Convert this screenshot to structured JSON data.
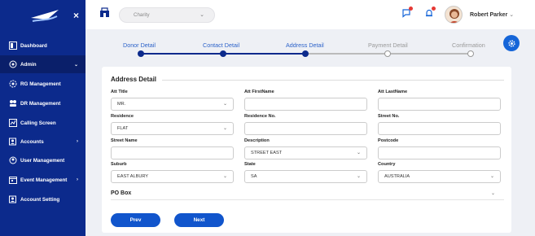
{
  "sidebar": {
    "close_label": "×",
    "items": [
      {
        "label": "Dashboard",
        "icon": "dashboard-icon"
      },
      {
        "label": "Admin",
        "icon": "admin-icon",
        "active": true,
        "chevron": "⌄"
      },
      {
        "label": "RG Management",
        "icon": "rg-management-icon"
      },
      {
        "label": "DR Management",
        "icon": "dr-management-icon"
      },
      {
        "label": "Calling Screen",
        "icon": "calling-screen-icon"
      },
      {
        "label": "Accounts",
        "icon": "accounts-icon",
        "chevron": "›"
      },
      {
        "label": "User Management",
        "icon": "user-management-icon"
      },
      {
        "label": "Event Management",
        "icon": "event-management-icon",
        "chevron": "›"
      },
      {
        "label": "Account Setting",
        "icon": "account-setting-icon"
      }
    ]
  },
  "topbar": {
    "charity_value": "Charity",
    "charity_arrow": "⌄",
    "user_name": "Robert Parker",
    "user_chevron": "⌄"
  },
  "stepper": {
    "steps": [
      {
        "label": "Donor Detail",
        "done": true
      },
      {
        "label": "Contact Detail",
        "done": true
      },
      {
        "label": "Address Detail",
        "done": true
      },
      {
        "label": "Payment Detail",
        "done": false
      },
      {
        "label": "Confirmation",
        "done": false
      }
    ]
  },
  "form": {
    "section_title": "Address Detail",
    "fields": {
      "att_title": {
        "label": "Att Title",
        "value": "MR."
      },
      "att_firstname": {
        "label": "Att FirstName",
        "value": ""
      },
      "att_lastname": {
        "label": "Att LastName",
        "value": ""
      },
      "residence": {
        "label": "Residence",
        "value": "FLAT"
      },
      "residence_no": {
        "label": "Residence No.",
        "value": ""
      },
      "street_no": {
        "label": "Street No.",
        "value": ""
      },
      "street_name": {
        "label": "Street Name",
        "value": ""
      },
      "description": {
        "label": "Description",
        "value": "STREET EAST"
      },
      "postcode": {
        "label": "Postcode",
        "value": ""
      },
      "suburb": {
        "label": "Suburb",
        "value": "EAST ALBURY"
      },
      "state": {
        "label": "State",
        "value": "SA"
      },
      "country": {
        "label": "Country",
        "value": "AUSTRALIA"
      }
    },
    "select_arrow": "⌄",
    "pobox_label": "PO Box",
    "prev_label": "Prev",
    "next_label": "Next"
  },
  "colors": {
    "sidebar": "#0c2a8c",
    "primary": "#1155cc",
    "step_active": "#2c62c9",
    "notification": "#e53935"
  }
}
